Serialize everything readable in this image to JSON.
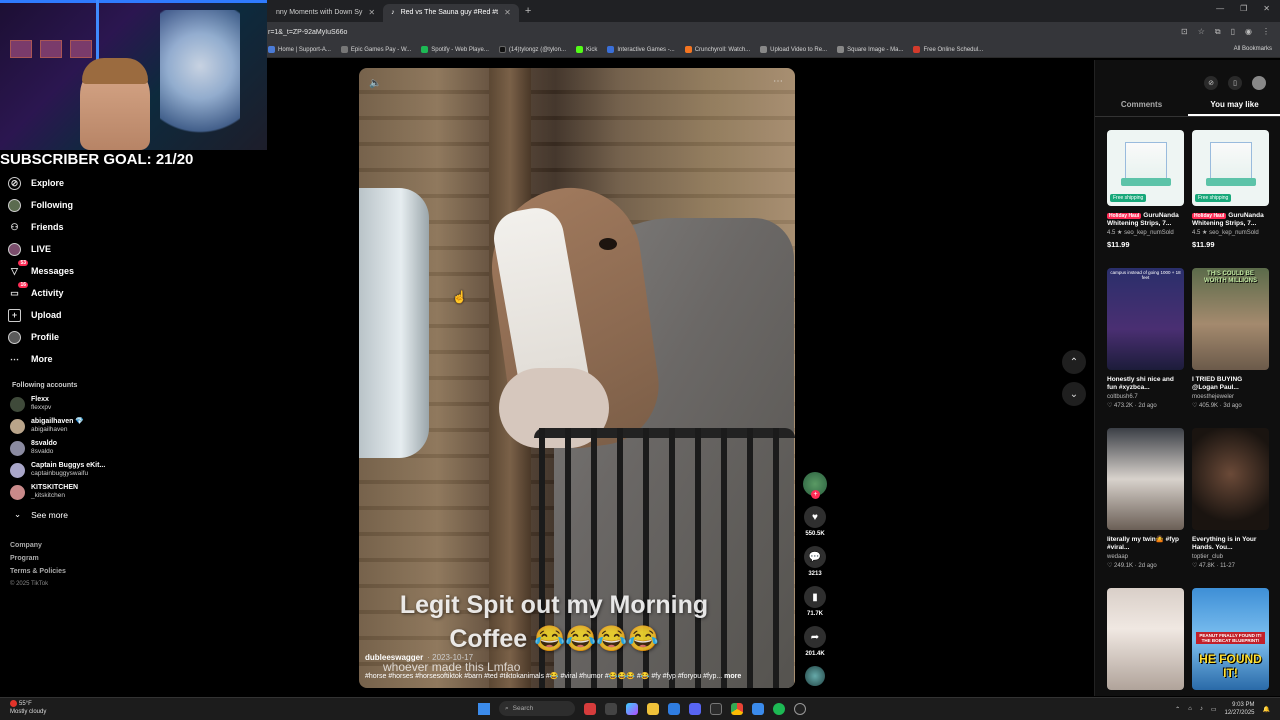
{
  "browser": {
    "tabs": [
      {
        "label": "nny Moments with Down Sy",
        "active": false
      },
      {
        "label": "Red vs The Sauna guy #Red #t",
        "active": true
      }
    ],
    "url": "r=1&_t=ZP-92aMyIuS66o",
    "bookmarks": [
      {
        "label": "Home | Support-A...",
        "color": "#4b7bd6"
      },
      {
        "label": "Epic Games Pay - W...",
        "color": "#777777"
      },
      {
        "label": "Spotify - Web Playe...",
        "color": "#1db954"
      },
      {
        "label": "(14)tylongz (@tylon...",
        "color": "#111111"
      },
      {
        "label": "Kick",
        "color": "#53fc18"
      },
      {
        "label": "Interactive Games -...",
        "color": "#3a6fd8"
      },
      {
        "label": "Crunchyroll: Watch...",
        "color": "#f47521"
      },
      {
        "label": "Upload Video to Re...",
        "color": "#888888"
      },
      {
        "label": "Square Image - Ma...",
        "color": "#888888"
      },
      {
        "label": "Free Online Schedul...",
        "color": "#d33b2c"
      }
    ],
    "all_bookmarks": "All Bookmarks"
  },
  "overlay": {
    "subscriber_goal": "SUBSCRIBER GOAL: 21/20"
  },
  "sidebar": {
    "items": [
      {
        "label": "Explore",
        "icon": "compass-icon",
        "glyph": "⊘"
      },
      {
        "label": "Following",
        "icon": "following-icon",
        "glyph": "●"
      },
      {
        "label": "Friends",
        "icon": "friends-icon",
        "glyph": "👥"
      },
      {
        "label": "LIVE",
        "icon": "live-icon",
        "glyph": "●"
      },
      {
        "label": "Messages",
        "icon": "messages-icon",
        "glyph": "▽",
        "badge": "53"
      },
      {
        "label": "Activity",
        "icon": "activity-icon",
        "glyph": "▭",
        "badge": "16"
      },
      {
        "label": "Upload",
        "icon": "upload-icon",
        "glyph": "⊞"
      },
      {
        "label": "Profile",
        "icon": "profile-icon",
        "glyph": "●"
      },
      {
        "label": "More",
        "icon": "more-icon",
        "glyph": "⋯"
      }
    ],
    "following_title": "Following accounts",
    "accounts": [
      {
        "name": "Flexx",
        "handle": "flexxpv"
      },
      {
        "name": "abigailhaven 💎",
        "handle": "abigailhaven"
      },
      {
        "name": "8svaldo",
        "handle": "8svaldo"
      },
      {
        "name": "Captain Buggys eKit...",
        "handle": "captainbuggyswaifu"
      },
      {
        "name": "KITSKITCHEN",
        "handle": "_kitskitchen"
      }
    ],
    "see_more": "See more",
    "footer": [
      "Company",
      "Program",
      "Terms & Policies"
    ],
    "copyright": "© 2025 TikTok"
  },
  "video": {
    "caption": "Legit Spit out my Morning Coffee 😂😂😂😂",
    "author": "dubleeswagger",
    "date": "· 2023-10-17",
    "overlay_text": "whoever made this Lmfao",
    "tags": "#horse #horses #horsesoftiktok #barn #ted #tiktokanimals #😂 #viral #humor #😂😂😂 #😂 #fy #fyp #foryou #fyp...",
    "more": "more"
  },
  "actions": {
    "likes": "550.5K",
    "comments": "3213",
    "saves": "71.7K",
    "shares": "201.4K"
  },
  "right_panel": {
    "tabs": [
      "Comments",
      "You may like"
    ],
    "active_tab": 1,
    "cards": [
      {
        "title": "GuruNanda Whitening Strips, 7...",
        "tag": "Holiday Haul",
        "rating": "4.5 ★",
        "sold": "seo_kep_numSold",
        "price": "$11.99",
        "ship": "Free shipping"
      },
      {
        "title": "GuruNanda Whitening Strips, 7...",
        "tag": "Holiday Haul",
        "rating": "4.5 ★",
        "sold": "seo_kep_numSold",
        "price": "$11.99",
        "ship": "Free shipping"
      },
      {
        "title": "Honestly shi nice and fun #xyzbca...",
        "author": "coltbush6.7",
        "likes": "♡ 473.2K",
        "date": "· 2d ago"
      },
      {
        "title": "I TRIED BUYING @Logan Paul...",
        "author": "moesthejeweler",
        "likes": "♡ 405.9K",
        "date": "· 3d ago"
      },
      {
        "title": "literally my twin🤷 #fyp #viral...",
        "author": "wedaap",
        "likes": "♡ 249.1K",
        "date": "· 2d ago"
      },
      {
        "title": "Everything is in Your Hands. You...",
        "author": "toptier_club",
        "likes": "♡ 47.8K",
        "date": "· 11-27"
      }
    ],
    "thumb_text_1": "campus instead of going 1000 + 18 feet",
    "thumb_text_2": "THIS COULD BE WORTH MILLIONS",
    "thumb_text_3": "HE FOUND IT!",
    "thumb_text_4": "PEANUT FINALLY FOUND IT! THE BOBCAT BLUEPRINT!"
  },
  "taskbar": {
    "temp": "55°F",
    "weather": "Mostly cloudy",
    "search": "Search",
    "time": "9:03 PM",
    "date": "12/27/2025"
  },
  "colors": {
    "accent": "#fe2c55",
    "freeship": "#18a87a"
  }
}
